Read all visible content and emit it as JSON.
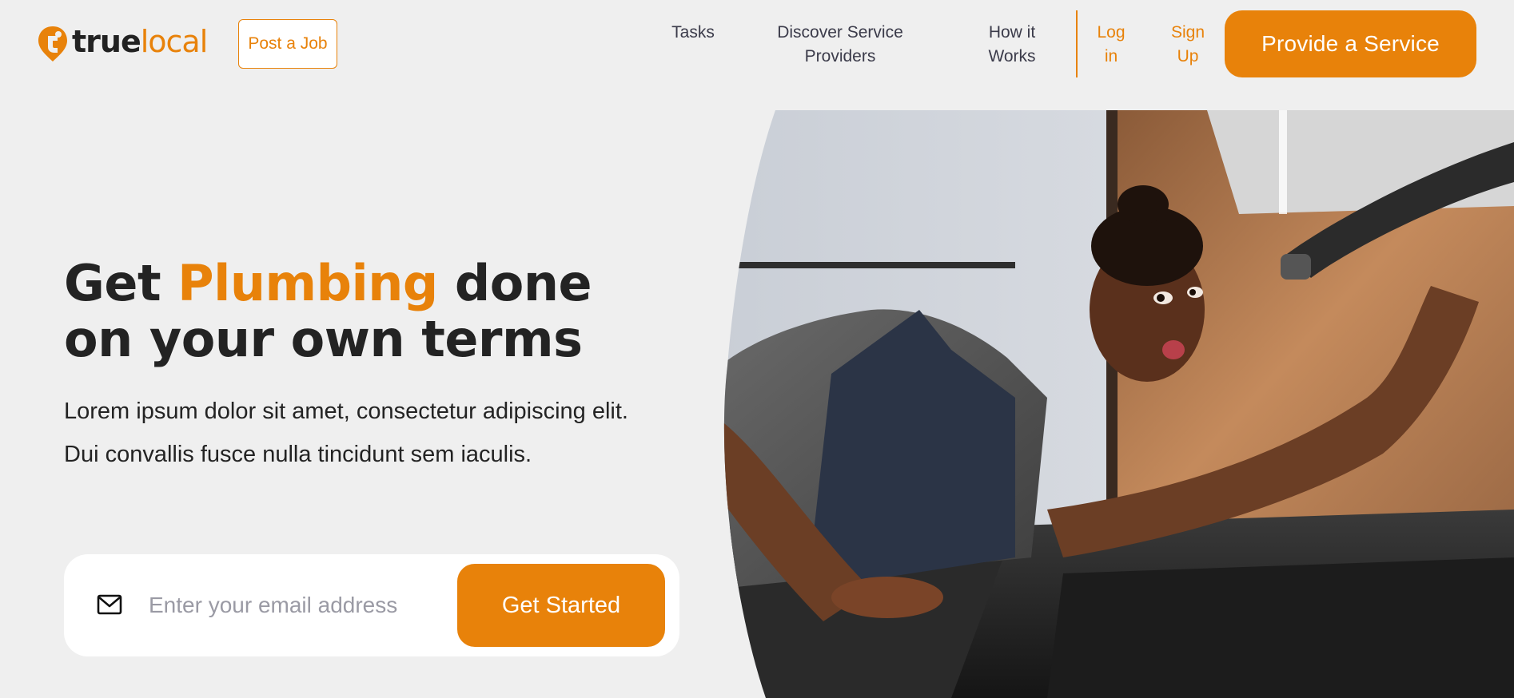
{
  "brand": {
    "name_part1": "true",
    "name_part2": "local",
    "accent": "#e8820a"
  },
  "header": {
    "post_job_label": "Post a Job",
    "nav": {
      "tasks": "Tasks",
      "discover_line1": "Discover Service",
      "discover_line2": "Providers",
      "how_line1": "How it",
      "how_line2": "Works",
      "login_line1": "Log",
      "login_line2": "in",
      "signup_line1": "Sign",
      "signup_line2": "Up"
    },
    "provide_service_label": "Provide a Service"
  },
  "hero": {
    "title_prefix": "Get ",
    "title_highlight": "Plumbing",
    "title_suffix": " done on your own terms",
    "description": "Lorem ipsum dolor sit amet, consectetur adipiscing elit. Dui convallis fusce nulla tincidunt sem iaculis.",
    "email_placeholder": "Enter your email address",
    "email_value": "",
    "cta_label": "Get Started",
    "mail_icon": "mail-icon",
    "image_subject": "plumber-woman-inspecting-faucet-photo"
  }
}
